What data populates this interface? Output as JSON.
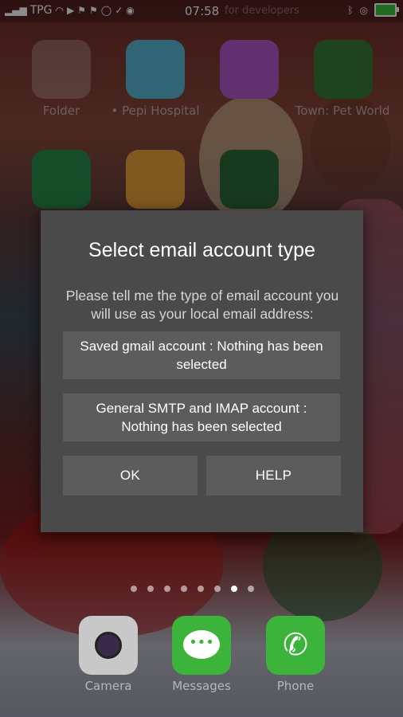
{
  "status_bar": {
    "carrier": "TPG",
    "time": "07:58",
    "ghost_text": "for developers",
    "icons": [
      "signal-icon",
      "wifi-icon",
      "play-icon",
      "flag-icon",
      "flag-icon",
      "flag-icon",
      "whatsapp-icon",
      "check-icon",
      "chrome-icon",
      "bluetooth-icon",
      "eye-icon",
      "battery-icon"
    ]
  },
  "home_apps": [
    {
      "label": "Folder"
    },
    {
      "label": "• Pepi Hospital"
    },
    {
      "label": ""
    },
    {
      "label": "Town: Pet World"
    },
    {
      "label": ""
    },
    {
      "label": ""
    },
    {
      "label": ""
    }
  ],
  "dock": [
    {
      "label": "Camera"
    },
    {
      "label": "Messages"
    },
    {
      "label": "Phone"
    }
  ],
  "page_indicator": {
    "count": 8,
    "active": 7
  },
  "dialog": {
    "title": "Select email account type",
    "message": "Please tell me the type of email account you will use as your local email address:",
    "option_gmail": "Saved gmail account : Nothing has been selected",
    "option_smtp": "General SMTP and IMAP account : Nothing has been selected",
    "ok_label": "OK",
    "help_label": "HELP"
  },
  "colors": {
    "dialog_bg": "#4a4a4a",
    "button_bg": "#5c5c5c",
    "text": "#ffffff"
  }
}
